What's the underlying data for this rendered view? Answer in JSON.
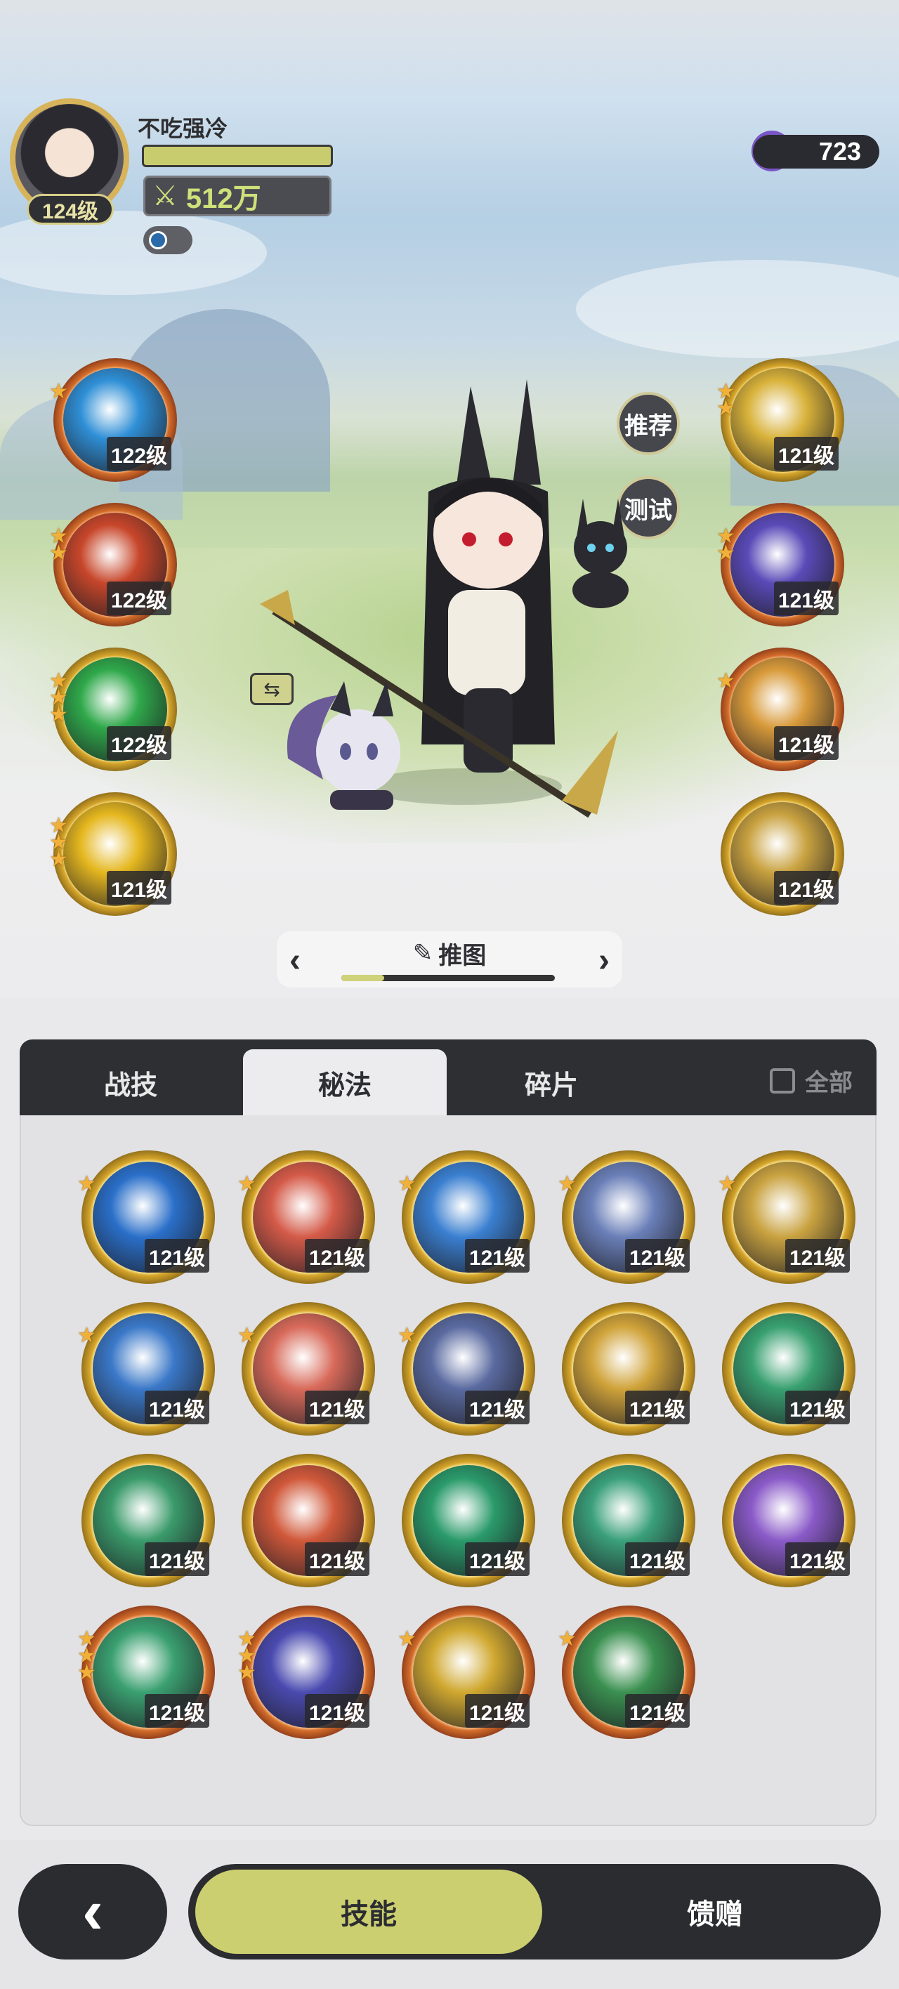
{
  "player": {
    "name": "不吃强冷",
    "level": "124级",
    "power": "512万"
  },
  "currency": {
    "amount": "723"
  },
  "side_buttons": {
    "recommend": "推荐",
    "test": "测试"
  },
  "left_skills": [
    {
      "level": "122级",
      "stars": 1,
      "color": "#2f8fd6",
      "frame": "orange"
    },
    {
      "level": "122级",
      "stars": 2,
      "color": "#c7462a",
      "frame": "orange"
    },
    {
      "level": "122级",
      "stars": 3,
      "color": "#2fa84a",
      "frame": "gold"
    },
    {
      "level": "121级",
      "stars": 3,
      "color": "#e5b71f",
      "frame": "gold"
    }
  ],
  "right_skills": [
    {
      "level": "121级",
      "stars": 2,
      "color": "#d8b23a",
      "frame": "gold"
    },
    {
      "level": "121级",
      "stars": 2,
      "color": "#5a4ab8",
      "frame": "orange"
    },
    {
      "level": "121级",
      "stars": 1,
      "color": "#d89a3a",
      "frame": "orange"
    },
    {
      "level": "121级",
      "stars": 0,
      "color": "#c9a240",
      "frame": "gold"
    }
  ],
  "stage": {
    "title": "推图",
    "progress": 0.2
  },
  "tabs": {
    "items": [
      "战技",
      "秘法",
      "碎片"
    ],
    "active": 1,
    "all_label": "全部"
  },
  "grid_skills": [
    {
      "level": "121级",
      "stars": 1,
      "color": "#2a6fc9",
      "frame": "gold"
    },
    {
      "level": "121级",
      "stars": 1,
      "color": "#d45a48",
      "frame": "gold"
    },
    {
      "level": "121级",
      "stars": 1,
      "color": "#3a7fd0",
      "frame": "gold"
    },
    {
      "level": "121级",
      "stars": 1,
      "color": "#6a7fb8",
      "frame": "gold"
    },
    {
      "level": "121级",
      "stars": 1,
      "color": "#c9a240",
      "frame": "gold"
    },
    {
      "level": "121级",
      "stars": 1,
      "color": "#3a78c8",
      "frame": "gold"
    },
    {
      "level": "121级",
      "stars": 1,
      "color": "#d86a5a",
      "frame": "gold"
    },
    {
      "level": "121级",
      "stars": 1,
      "color": "#5a6aa0",
      "frame": "gold"
    },
    {
      "level": "121级",
      "stars": 0,
      "color": "#d0a33a",
      "frame": "gold"
    },
    {
      "level": "121级",
      "stars": 0,
      "color": "#38a070",
      "frame": "gold"
    },
    {
      "level": "121级",
      "stars": 0,
      "color": "#3a9a6a",
      "frame": "gold"
    },
    {
      "level": "121级",
      "stars": 0,
      "color": "#d0583a",
      "frame": "gold"
    },
    {
      "level": "121级",
      "stars": 0,
      "color": "#2a9a6a",
      "frame": "gold"
    },
    {
      "level": "121级",
      "stars": 0,
      "color": "#3aa07a",
      "frame": "gold"
    },
    {
      "level": "121级",
      "stars": 0,
      "color": "#8a5ac8",
      "frame": "gold"
    },
    {
      "level": "121级",
      "stars": 3,
      "color": "#3aa070",
      "frame": "orange"
    },
    {
      "level": "121级",
      "stars": 3,
      "color": "#4a4ab0",
      "frame": "orange"
    },
    {
      "level": "121级",
      "stars": 1,
      "color": "#d0a830",
      "frame": "orange"
    },
    {
      "level": "121级",
      "stars": 1,
      "color": "#3a9050",
      "frame": "orange"
    }
  ],
  "bottom": {
    "tabs": [
      "技能",
      "馈赠"
    ],
    "active": 0
  }
}
